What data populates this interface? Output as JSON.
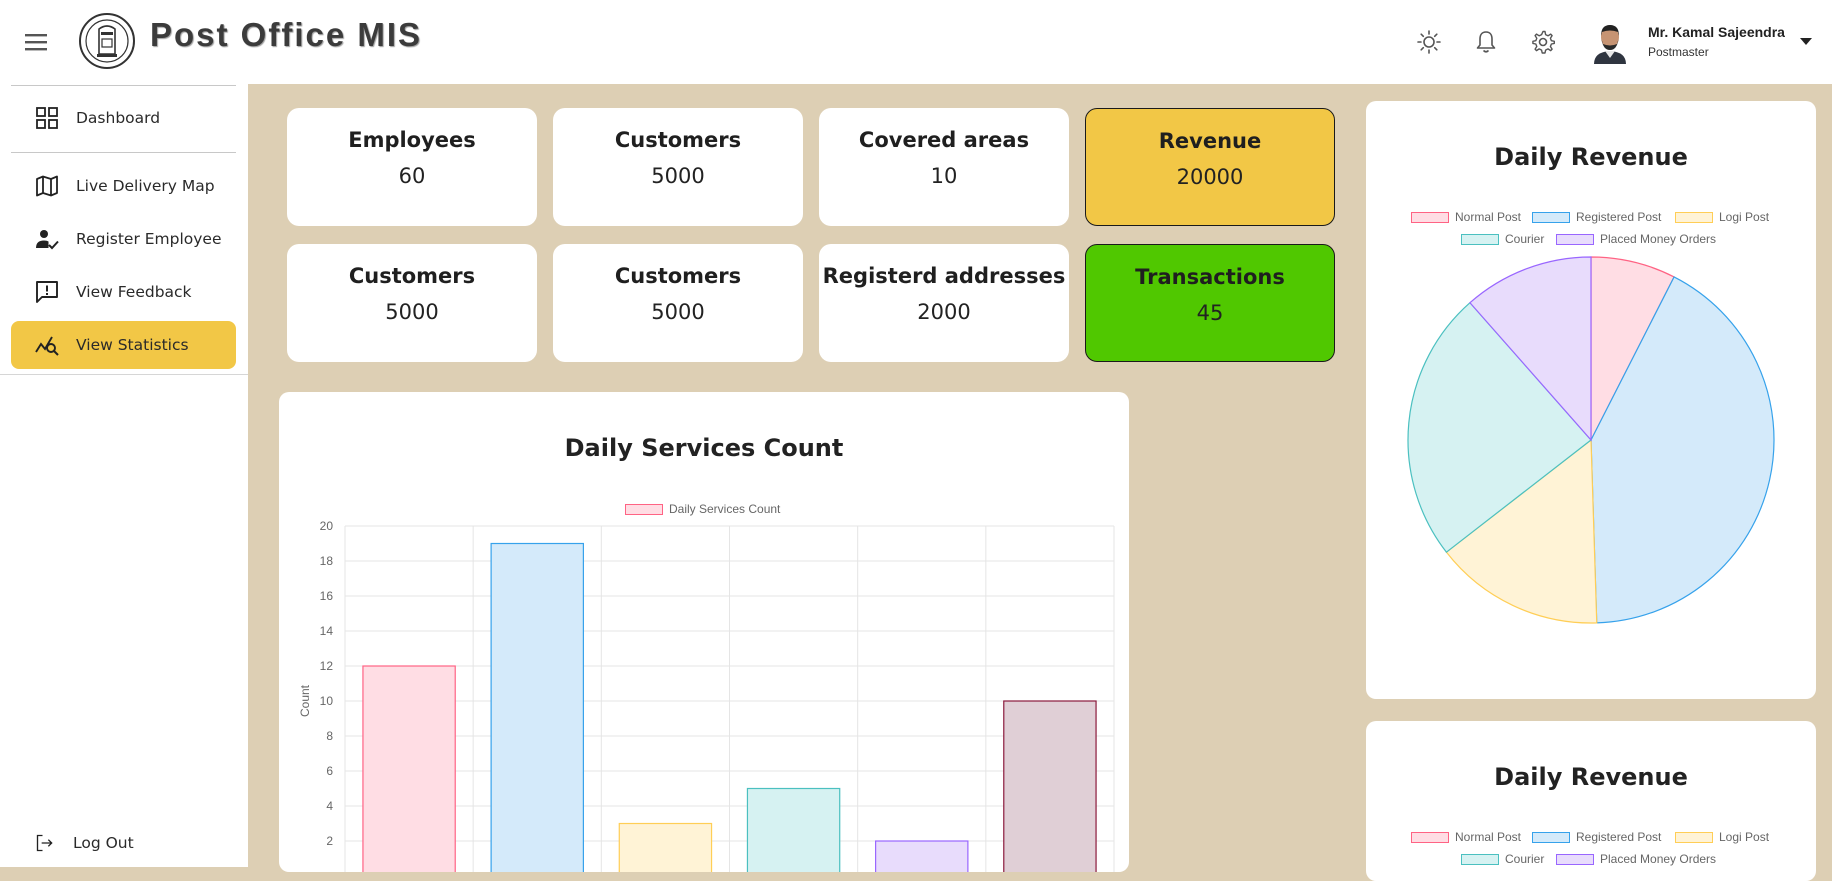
{
  "header": {
    "app_title": "Post Office MIS",
    "user": {
      "name": "Mr. Kamal Sajeendra",
      "role": "Postmaster"
    }
  },
  "sidebar": {
    "items": [
      {
        "label": "Dashboard",
        "icon": "grid-icon",
        "active": false
      },
      {
        "label": "Live Delivery Map",
        "icon": "map-icon",
        "active": false
      },
      {
        "label": "Register Employee",
        "icon": "user-check-icon",
        "active": false
      },
      {
        "label": "View Feedback",
        "icon": "feedback-icon",
        "active": false
      },
      {
        "label": "View Statistics",
        "icon": "stats-icon",
        "active": true
      }
    ],
    "logout": {
      "label": "Log Out",
      "icon": "logout-icon"
    }
  },
  "stats": [
    {
      "label": "Employees",
      "value": "60",
      "highlight": "none"
    },
    {
      "label": "Customers",
      "value": "5000",
      "highlight": "none"
    },
    {
      "label": "Covered areas",
      "value": "10",
      "highlight": "none"
    },
    {
      "label": "Revenue",
      "value": "20000",
      "highlight": "yellow"
    },
    {
      "label": "Customers",
      "value": "5000",
      "highlight": "none"
    },
    {
      "label": "Customers",
      "value": "5000",
      "highlight": "none"
    },
    {
      "label": "Registerd addresses",
      "value": "2000",
      "highlight": "none"
    },
    {
      "label": "Transactions",
      "value": "45",
      "highlight": "green"
    }
  ],
  "colors": {
    "accent_yellow": "#f2c746",
    "accent_green": "#50c800",
    "background": "#ddcfb4"
  },
  "chart_data": [
    {
      "type": "bar",
      "title": "Daily Services Count",
      "ylabel": "Count",
      "ylim": [
        0,
        20
      ],
      "yticks": [
        2,
        4,
        6,
        8,
        10,
        12,
        14,
        16,
        18,
        20
      ],
      "grid": true,
      "legend": "top",
      "series": [
        {
          "name": "Daily Services Count",
          "values": [
            12,
            19,
            3,
            5,
            2,
            10
          ],
          "fill_colors": [
            "#ffdde4",
            "#d4eafa",
            "#fff3d6",
            "#d6f2f2",
            "#e8dcfc",
            "#e0cfd6"
          ],
          "border_colors": [
            "#ff6384",
            "#36a2eb",
            "#ffce56",
            "#4bc0c0",
            "#9966ff",
            "#8b1a3c"
          ]
        }
      ]
    },
    {
      "type": "pie",
      "title": "Daily Revenue",
      "legend": "top",
      "categories": [
        "Normal Post",
        "Registered Post",
        "Logi Post",
        "Courier",
        "Placed Money Orders"
      ],
      "values": [
        7.5,
        42,
        15,
        24,
        11.5
      ],
      "fill_colors": [
        "#ffdde4",
        "#d4eafa",
        "#fff3d6",
        "#d6f2f2",
        "#e8dcfc"
      ],
      "border_colors": [
        "#ff6384",
        "#36a2eb",
        "#ffce56",
        "#4bc0c0",
        "#9966ff"
      ]
    },
    {
      "type": "pie",
      "title": "Daily Revenue",
      "legend": "top",
      "categories": [
        "Normal Post",
        "Registered Post",
        "Logi Post",
        "Courier",
        "Placed Money Orders"
      ],
      "values": [],
      "fill_colors": [
        "#ffdde4",
        "#d4eafa",
        "#fff3d6",
        "#d6f2f2",
        "#e8dcfc"
      ],
      "border_colors": [
        "#ff6384",
        "#36a2eb",
        "#ffce56",
        "#4bc0c0",
        "#9966ff"
      ]
    }
  ]
}
